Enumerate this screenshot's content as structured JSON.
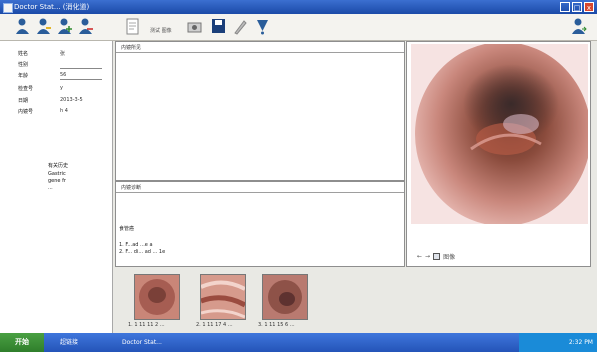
{
  "window": {
    "title": "Doctor Stat... (消化道)",
    "min": "_",
    "max": "□",
    "close": "x"
  },
  "toolbar": {
    "items": [
      {
        "label": "",
        "icon": "user-icon"
      },
      {
        "label": "",
        "icon": "user-edit-icon"
      },
      {
        "label": "",
        "icon": "user-add-icon"
      },
      {
        "label": "",
        "icon": "user-remove-icon"
      },
      {
        "label": "",
        "icon": "report-icon"
      },
      {
        "label": "",
        "icon": "capture-icon"
      },
      {
        "label": "",
        "icon": "print-icon"
      },
      {
        "label": "",
        "icon": "save-icon"
      },
      {
        "label": "",
        "icon": "edit-icon"
      },
      {
        "label": "",
        "icon": "help-icon"
      }
    ],
    "text_label": "测试 图像",
    "exit_icon": "exit-icon"
  },
  "patient": {
    "fields": [
      {
        "label": "姓名",
        "value": "张"
      },
      {
        "label": "性别",
        "value": ""
      },
      {
        "label": "年龄",
        "value": "56"
      },
      {
        "label": "检查号",
        "value": "y"
      },
      {
        "label": "日期",
        "value": "2013-3-5"
      },
      {
        "label": "内镜号",
        "value": "h 4"
      }
    ],
    "extra": {
      "title": "有关历史",
      "lines": [
        "Gastric",
        "gene fr",
        "..."
      ]
    }
  },
  "findings": {
    "header": "内镜所见"
  },
  "diagnosis": {
    "header": "内镜诊断",
    "line1": "食管癌",
    "line2": "1. F...ad ...e a",
    "line3": "2. F... di... ad ... 1e"
  },
  "image_panel": {
    "controls": [
      "←",
      "→"
    ],
    "label": "图像"
  },
  "thumbnails": [
    {
      "caption": "1. 1 11 11 2 ..."
    },
    {
      "caption": "2. 1 11 17 4 ..."
    },
    {
      "caption": "3. 1 11 15 6 ..."
    }
  ],
  "taskbar": {
    "start": "开始",
    "items": [
      "超链接",
      "Doctor Stat..."
    ],
    "clock": "2:32 PM"
  }
}
